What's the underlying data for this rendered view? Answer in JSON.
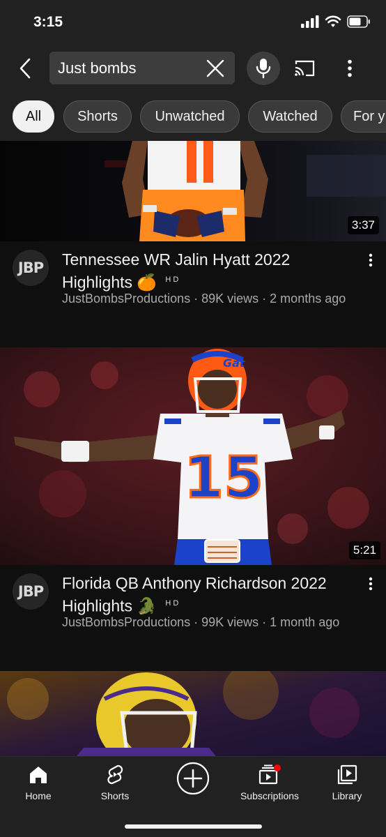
{
  "status_bar": {
    "time": "3:15"
  },
  "search": {
    "query": "Just bombs"
  },
  "filters": [
    {
      "label": "All",
      "active": true
    },
    {
      "label": "Shorts",
      "active": false
    },
    {
      "label": "Unwatched",
      "active": false
    },
    {
      "label": "Watched",
      "active": false
    },
    {
      "label": "For y",
      "active": false
    }
  ],
  "videos": [
    {
      "duration": "3:37",
      "channel_avatar": "JBP",
      "title": "Tennessee WR Jalin Hyatt 2022 Highlights",
      "emoji": "🍊",
      "quality_badge": "HD",
      "channel": "JustBombsProductions",
      "views": "89K views",
      "age": "2 months ago"
    },
    {
      "duration": "5:21",
      "channel_avatar": "JBP",
      "title": "Florida QB Anthony Richardson 2022 Highlights",
      "emoji": "🐊",
      "quality_badge": "HD",
      "channel": "JustBombsProductions",
      "views": "99K views",
      "age": "1 month ago"
    }
  ],
  "bottom_nav": {
    "home": "Home",
    "shorts": "Shorts",
    "subscriptions": "Subscriptions",
    "library": "Library"
  },
  "colors": {
    "background": "#0f0f0f",
    "header": "#212121",
    "notification_dot": "#ff0000",
    "meta_text": "#aaaaaa"
  }
}
